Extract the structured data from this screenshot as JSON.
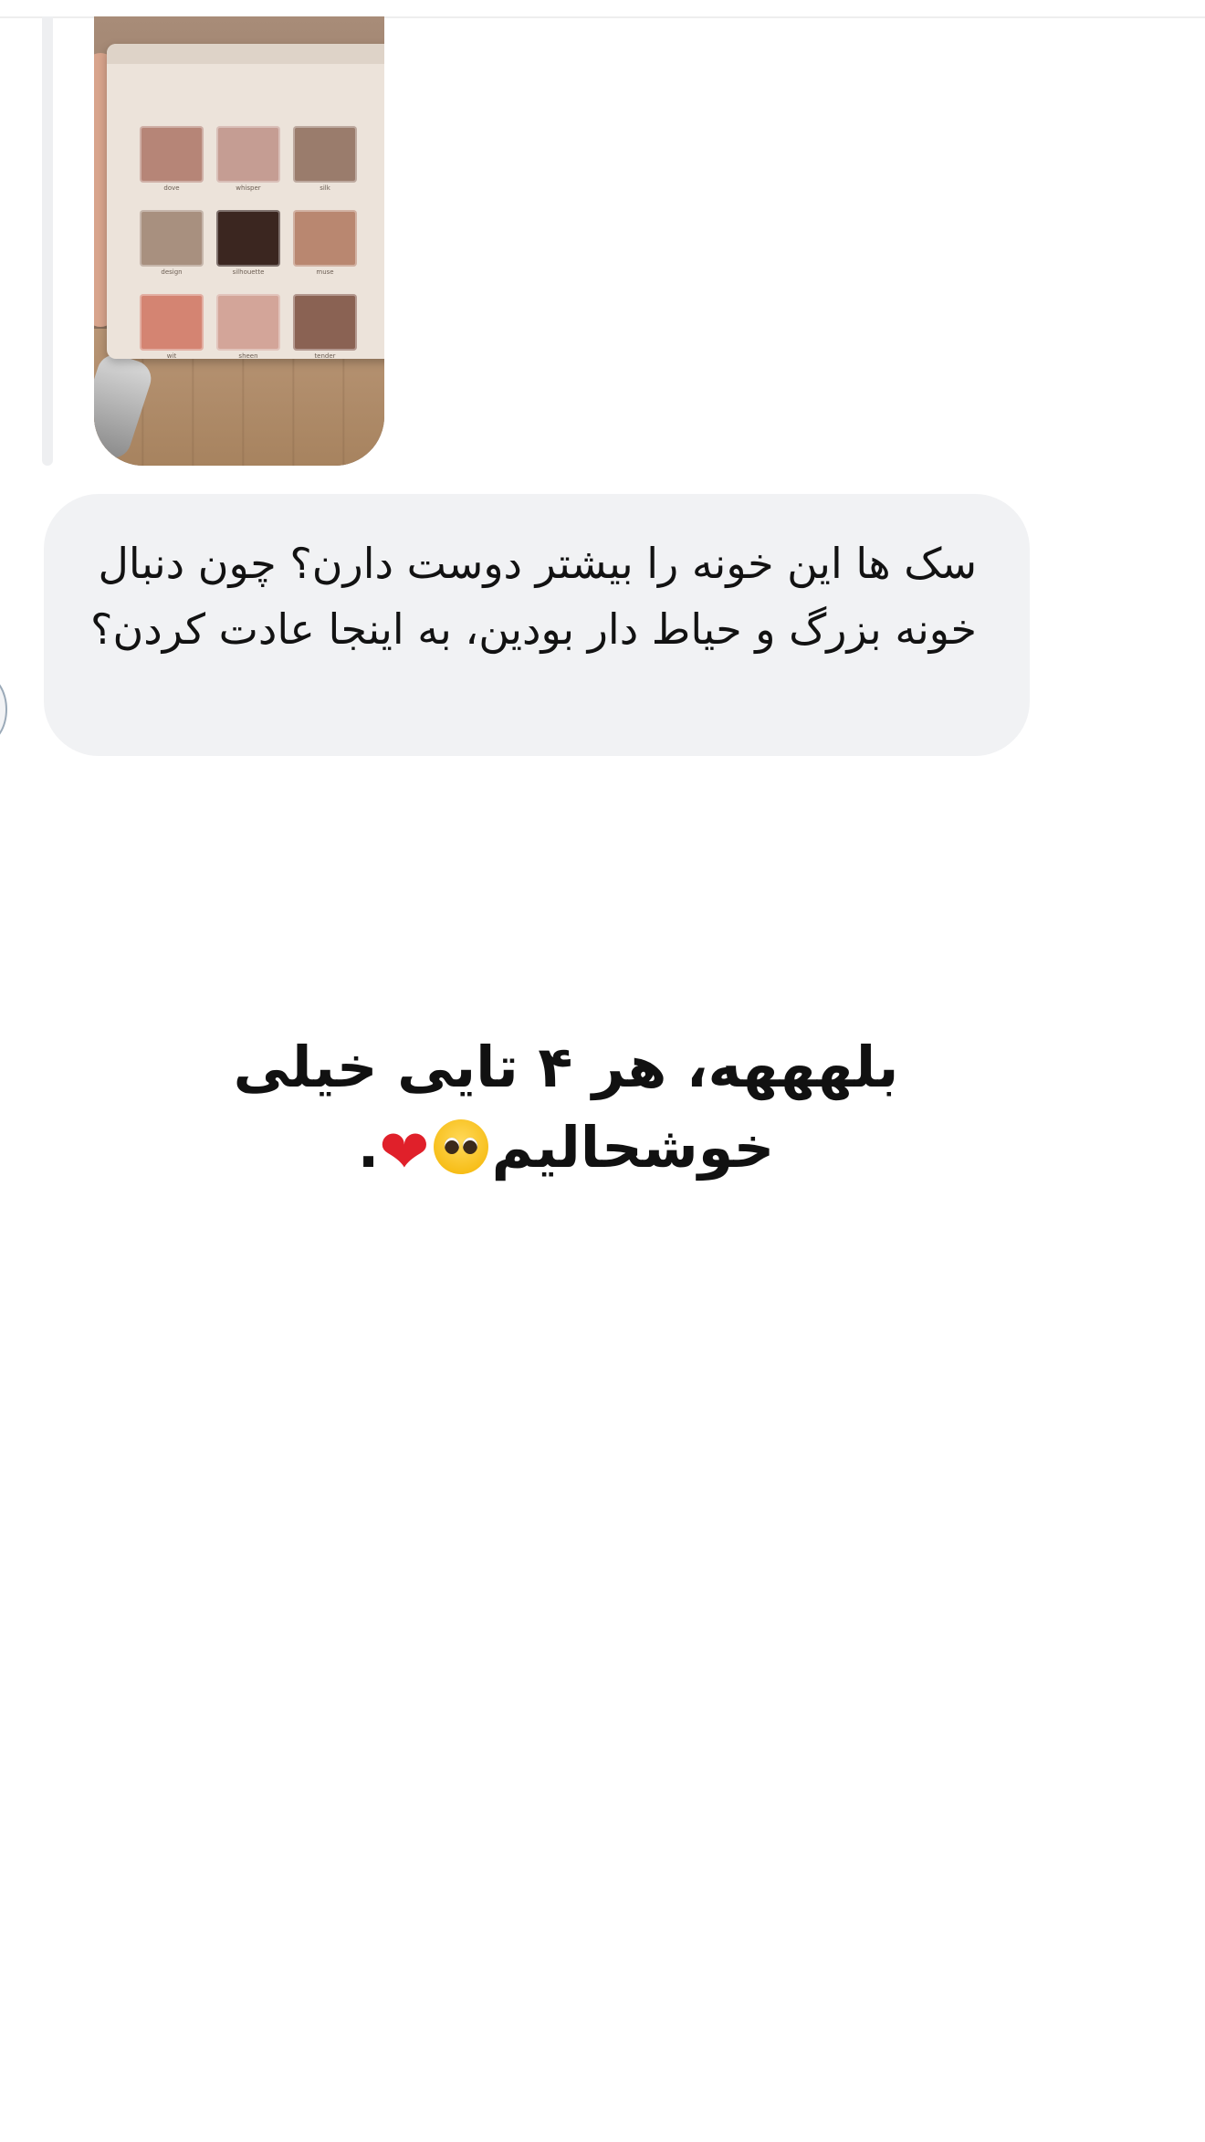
{
  "thread": {
    "attachment": {
      "image_alt": "eyeshadow palette photo",
      "pans": [
        {
          "label": "dove",
          "color": "#b68577"
        },
        {
          "label": "whisper",
          "color": "#c59d93"
        },
        {
          "label": "silk",
          "color": "#9a7c6c"
        },
        {
          "label": "design",
          "color": "#a8907f"
        },
        {
          "label": "silhouette",
          "color": "#3b2620"
        },
        {
          "label": "muse",
          "color": "#b98770"
        },
        {
          "label": "wit",
          "color": "#d48472"
        },
        {
          "label": "sheen",
          "color": "#d3a599"
        },
        {
          "label": "tender",
          "color": "#8a6253"
        }
      ]
    },
    "question": {
      "text": "سک ها این خونه را بیشتر دوست دارن؟ چون دنبال خونه بزرگ و حیاط دار بودین، به اینجا عادت کردن؟"
    }
  },
  "answer": {
    "text": "بلهههه، هر ۴ تایی خیلی خوشحالیم",
    "emoji": [
      "pleading-face-icon",
      "red-heart-icon"
    ],
    "trailing": "."
  },
  "colors": {
    "bubble_background": "#f1f2f4",
    "text": "#121212",
    "heart": "#e0202a"
  }
}
